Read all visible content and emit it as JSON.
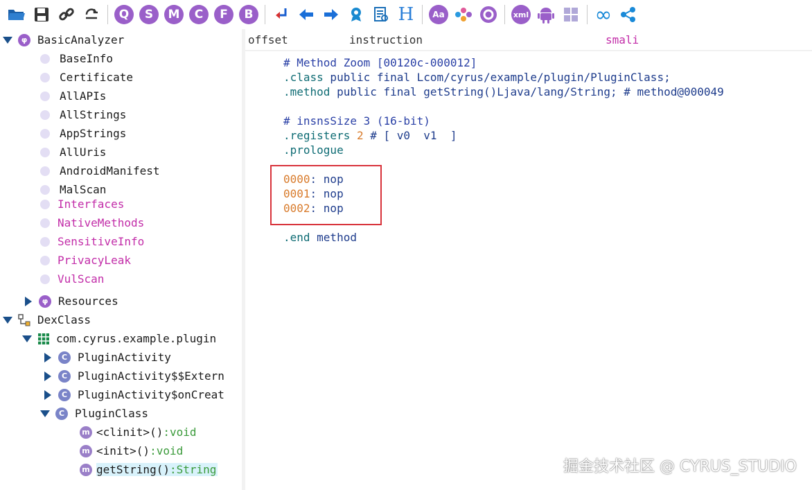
{
  "toolbar": {
    "buttons": [
      {
        "icon": "open-folder-icon"
      },
      {
        "icon": "save-icon"
      },
      {
        "icon": "link-icon"
      },
      {
        "icon": "refresh-icon"
      },
      {
        "icon": "circle-q",
        "letter": "Q"
      },
      {
        "icon": "circle-s",
        "letter": "S"
      },
      {
        "icon": "circle-m",
        "letter": "M"
      },
      {
        "icon": "circle-c",
        "letter": "C"
      },
      {
        "icon": "circle-f",
        "letter": "F"
      },
      {
        "icon": "circle-b",
        "letter": "B"
      },
      {
        "icon": "jump-icon"
      },
      {
        "icon": "back-icon"
      },
      {
        "icon": "forward-icon"
      },
      {
        "icon": "badge-icon"
      },
      {
        "icon": "report-icon"
      },
      {
        "icon": "hex-icon",
        "letter": "H"
      },
      {
        "icon": "font-icon",
        "letter": "Aa"
      },
      {
        "icon": "graph-icon"
      },
      {
        "icon": "settings-icon"
      },
      {
        "icon": "xml-icon",
        "letter": "xml"
      },
      {
        "icon": "android-icon"
      },
      {
        "icon": "windows-icon"
      },
      {
        "icon": "infinity-icon"
      },
      {
        "icon": "share-icon"
      }
    ]
  },
  "tree": {
    "basic_analyzer": "BasicAnalyzer",
    "basic_items": [
      "BaseInfo",
      "Certificate",
      "AllAPIs",
      "AllStrings",
      "AppStrings",
      "AllUris",
      "AndroidManifest",
      "MalScan"
    ],
    "pink_items": [
      "Interfaces",
      "NativeMethods",
      "SensitiveInfo",
      "PrivacyLeak",
      "VulScan"
    ],
    "resources": "Resources",
    "dexclass": "DexClass",
    "package": "com.cyrus.example.plugin",
    "classes": [
      "PluginActivity",
      "PluginActivity$$Extern",
      "PluginActivity$onCreat",
      "PluginClass"
    ],
    "methods": [
      {
        "name": "<clinit>()",
        "ret": ":void"
      },
      {
        "name": "<init>()",
        "ret": ":void"
      },
      {
        "name": "getString()",
        "ret": ":String"
      }
    ]
  },
  "columns": {
    "offset": "offset",
    "instruction": "instruction",
    "smali": "smali"
  },
  "code": {
    "l1": "# Method Zoom [00120c-000012]",
    "l2_kw": ".class",
    "l2_rest": " public final Lcom/cyrus/example/plugin/PluginClass;",
    "l3_kw": ".method",
    "l3_rest": " public final getString()Ljava/lang/String; # method@000049",
    "l4": "# insnsSize 3 (16-bit)",
    "l5_kw": ".registers",
    "l5_num": " 2",
    "l5_rest": " # [ v0  v1  ]",
    "l6_kw": ".prologue",
    "ops": [
      {
        "off": "0000",
        "ins": ": nop"
      },
      {
        "off": "0001",
        "ins": ": nop"
      },
      {
        "off": "0002",
        "ins": ": nop"
      }
    ],
    "end_kw": ".end",
    "end_rest": " method"
  },
  "watermark": "掘金技术社区 @ CYRUS_STUDIO"
}
